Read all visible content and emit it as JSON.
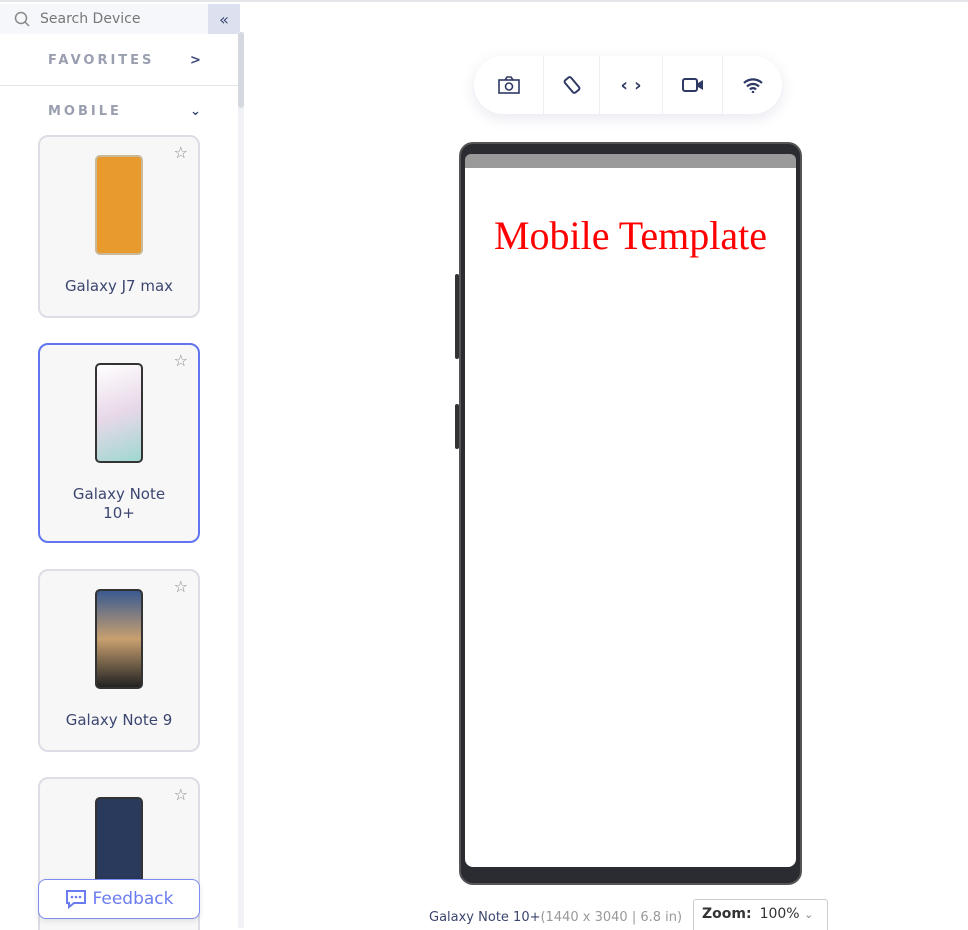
{
  "sidebar": {
    "search_placeholder": "Search Device",
    "collapse_icon": "double-chevron-left",
    "sections": [
      {
        "label": "FAVORITES",
        "expanded": false
      },
      {
        "label": "MOBILE",
        "expanded": true
      }
    ],
    "devices": [
      {
        "name": "Galaxy J7 max",
        "selected": false,
        "screen_color": "#e89a2c"
      },
      {
        "name": "Galaxy Note 10+",
        "selected": true,
        "screen_color": "#e8e6ee"
      },
      {
        "name": "Galaxy Note 9",
        "selected": false,
        "screen_color": "#5a78a8"
      },
      {
        "name": "",
        "selected": false,
        "screen_color": "#2a3a5c"
      }
    ],
    "feedback_label": "Feedback"
  },
  "toolbar": {
    "icons": [
      "camera-icon",
      "rotate-icon",
      "code-icon",
      "video-icon",
      "wifi-icon"
    ]
  },
  "screen": {
    "content_title": "Mobile Template"
  },
  "footer": {
    "device_name": "Galaxy Note 10+",
    "device_specs": "(1440 x 3040 | 6.8 in)",
    "zoom_label": "Zoom:",
    "zoom_value": "100%"
  }
}
